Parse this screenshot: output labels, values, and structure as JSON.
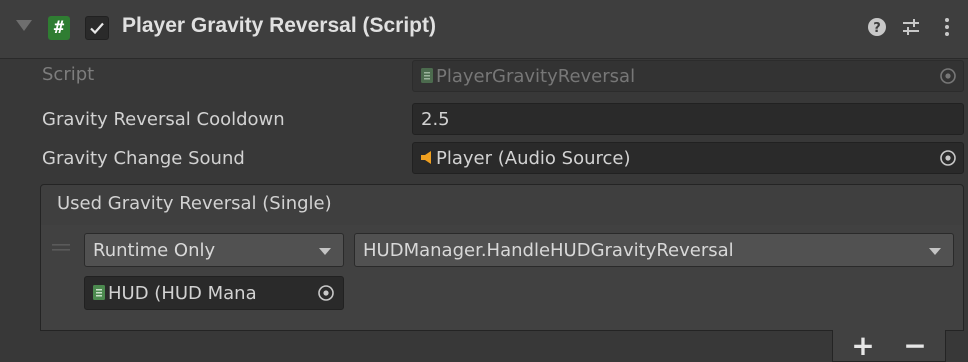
{
  "header": {
    "script_icon_glyph": "#",
    "enabled": true,
    "title": "Player Gravity Reversal (Script)"
  },
  "properties": [
    {
      "label": "Script",
      "value": "PlayerGravityReversal",
      "disabled": true,
      "icon": "script-asset-icon"
    },
    {
      "label": "Gravity Reversal Cooldown",
      "value": "2.5"
    },
    {
      "label": "Gravity Change Sound",
      "value": "Player (Audio Source)",
      "icon": "audio-source-icon"
    }
  ],
  "event": {
    "header_label": "Used Gravity Reversal (Single)",
    "listener": {
      "call_state": "Runtime Only",
      "function": "HUDManager.HandleHUDGravityReversal",
      "target": "HUD (HUD Mana"
    },
    "add_label": "+",
    "remove_label": "−"
  },
  "colors": {
    "panel_bg": "#383838",
    "header_bg": "#3e3e3e",
    "field_bg": "#2a2a2a",
    "script_icon_green": "#2f7d32",
    "audio_icon_orange": "#f0a020"
  }
}
